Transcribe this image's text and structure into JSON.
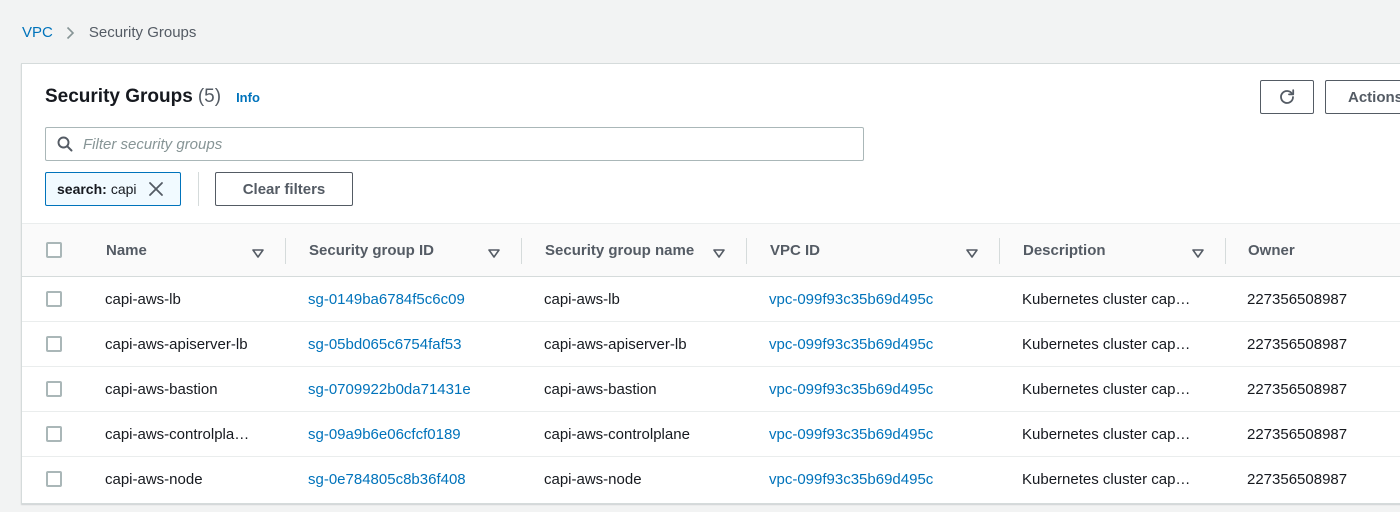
{
  "breadcrumb": {
    "parent": "VPC",
    "current": "Security Groups"
  },
  "header": {
    "title": "Security Groups",
    "count": "(5)",
    "info": "Info",
    "actions_label": "Actions"
  },
  "search": {
    "placeholder": "Filter security groups",
    "value": ""
  },
  "filter": {
    "token_key": "search:",
    "token_value": "capi",
    "clear_label": "Clear filters"
  },
  "table": {
    "columns": [
      "Name",
      "Security group ID",
      "Security group name",
      "VPC ID",
      "Description",
      "Owner"
    ],
    "rows": [
      {
        "name": "capi-aws-lb",
        "sg_id": "sg-0149ba6784f5c6c09",
        "sg_name": "capi-aws-lb",
        "vpc_id": "vpc-099f93c35b69d495c",
        "description": "Kubernetes cluster cap…",
        "owner": "227356508987"
      },
      {
        "name": "capi-aws-apiserver-lb",
        "sg_id": "sg-05bd065c6754faf53",
        "sg_name": "capi-aws-apiserver-lb",
        "vpc_id": "vpc-099f93c35b69d495c",
        "description": "Kubernetes cluster cap…",
        "owner": "227356508987"
      },
      {
        "name": "capi-aws-bastion",
        "sg_id": "sg-0709922b0da71431e",
        "sg_name": "capi-aws-bastion",
        "vpc_id": "vpc-099f93c35b69d495c",
        "description": "Kubernetes cluster cap…",
        "owner": "227356508987"
      },
      {
        "name": "capi-aws-controlpla…",
        "sg_id": "sg-09a9b6e06cfcf0189",
        "sg_name": "capi-aws-controlplane",
        "vpc_id": "vpc-099f93c35b69d495c",
        "description": "Kubernetes cluster cap…",
        "owner": "227356508987"
      },
      {
        "name": "capi-aws-node",
        "sg_id": "sg-0e784805c8b36f408",
        "sg_name": "capi-aws-node",
        "vpc_id": "vpc-099f93c35b69d495c",
        "description": "Kubernetes cluster cap…",
        "owner": "227356508987"
      }
    ]
  },
  "icons": {
    "breadcrumb_separator": "chevron-right-icon",
    "refresh": "refresh-icon",
    "search": "search-icon",
    "dismiss": "close-icon",
    "sort": "caret-down-icon"
  },
  "colors": {
    "link": "#0073bb",
    "text": "#16191f",
    "muted": "#545b64",
    "background": "#f2f3f3",
    "token_border": "#0073bb"
  }
}
